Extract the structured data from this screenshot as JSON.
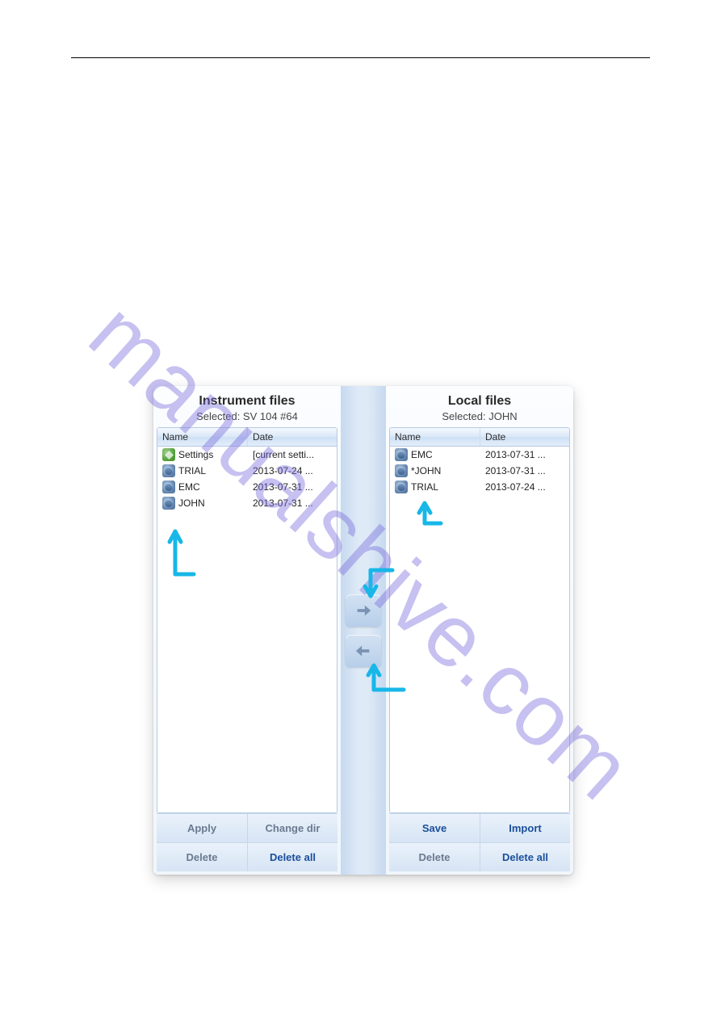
{
  "watermark": "manualshive.com",
  "instrument": {
    "title": "Instrument files",
    "subtitle": "Selected: SV 104 #64",
    "headers": {
      "name": "Name",
      "date": "Date"
    },
    "rows": [
      {
        "icon": "gear",
        "name": "Settings",
        "date": "[current setti..."
      },
      {
        "icon": "setup",
        "name": "TRIAL",
        "date": "2013-07-24 ..."
      },
      {
        "icon": "setup",
        "name": "EMC",
        "date": "2013-07-31 ..."
      },
      {
        "icon": "setup",
        "name": "JOHN",
        "date": "2013-07-31 ..."
      }
    ],
    "buttons": {
      "apply": "Apply",
      "change_dir": "Change dir",
      "delete": "Delete",
      "delete_all": "Delete all"
    }
  },
  "local": {
    "title": "Local files",
    "subtitle": "Selected: JOHN",
    "headers": {
      "name": "Name",
      "date": "Date"
    },
    "rows": [
      {
        "icon": "setup",
        "name": "EMC",
        "date": "2013-07-31 ..."
      },
      {
        "icon": "setup",
        "name": "*JOHN",
        "date": "2013-07-31 ..."
      },
      {
        "icon": "setup",
        "name": "TRIAL",
        "date": "2013-07-24 ..."
      }
    ],
    "buttons": {
      "save": "Save",
      "import": "Import",
      "delete": "Delete",
      "delete_all": "Delete all"
    }
  },
  "transfer": {
    "to_local_label": "→",
    "to_instrument_label": "←"
  },
  "layout": {
    "col_name_width": 112,
    "col_date_width": 112
  }
}
